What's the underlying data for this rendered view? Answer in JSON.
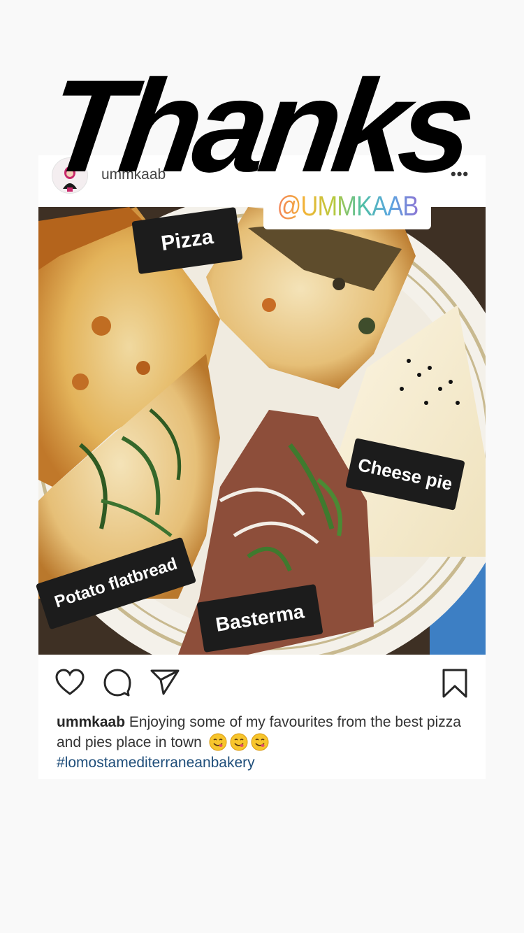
{
  "story": {
    "headline": "Thanks",
    "mention": "@UMMKAAB"
  },
  "post": {
    "username": "ummkaab",
    "more_icon": "more-horizontal-icon",
    "tags": {
      "pizza": "Pizza",
      "cheese_pie": "Cheese pie",
      "potato_flatbread": "Potato flatbread",
      "basterma": "Basterma"
    },
    "actions": [
      "heart-icon",
      "comment-icon",
      "share-icon",
      "bookmark-icon"
    ],
    "caption": {
      "username": "ummkaab",
      "text": "Enjoying some of my favourites from the best pizza and pies place in town",
      "emojis": [
        "savoring-face-emoji",
        "savoring-face-emoji",
        "savoring-face-emoji"
      ],
      "hashtag": "#lomostamediterraneanbakery"
    }
  },
  "colors": {
    "background": "#f9f9f9",
    "card": "#ffffff",
    "tag_background": "#1c1c1c",
    "hashtag": "#1f4e7a"
  }
}
